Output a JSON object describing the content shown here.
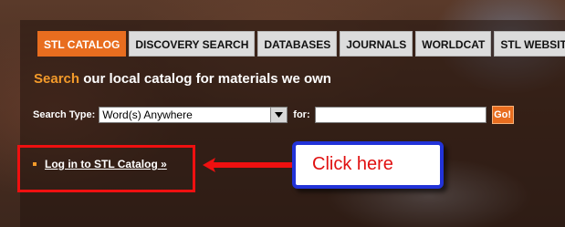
{
  "tabs": [
    {
      "label": "STL CATALOG",
      "active": true
    },
    {
      "label": "DISCOVERY SEARCH",
      "active": false
    },
    {
      "label": "DATABASES",
      "active": false
    },
    {
      "label": "JOURNALS",
      "active": false
    },
    {
      "label": "WORLDCAT",
      "active": false
    },
    {
      "label": "STL WEBSITE",
      "active": false
    }
  ],
  "headline": {
    "accent": "Search",
    "rest": " our local catalog for materials we own"
  },
  "search": {
    "type_label": "Search Type:",
    "type_value": "Word(s) Anywhere",
    "for_label": "for:",
    "query_value": "",
    "go_label": "Go!"
  },
  "login": {
    "label": "Log in to STL Catalog",
    "chevron": "»"
  },
  "callout": {
    "text": "Click here"
  },
  "colors": {
    "accent": "#e86d1f",
    "annotation_red": "#ef1010",
    "callout_border": "#2233d8"
  }
}
